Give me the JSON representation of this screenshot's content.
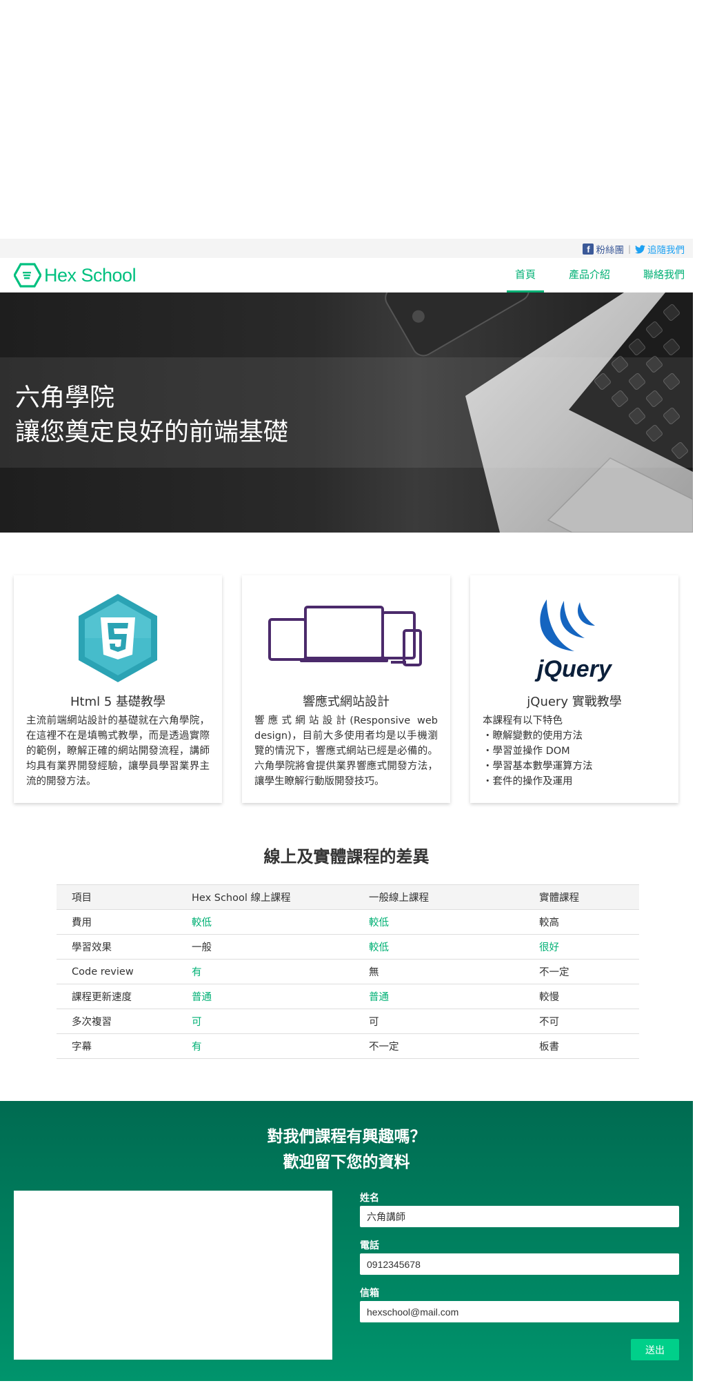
{
  "topbar": {
    "facebook_label": "粉絲團",
    "twitter_label": "追隨我們"
  },
  "logo": {
    "text": "Hex School",
    "icon": "hexagon-logo-icon"
  },
  "nav": {
    "items": [
      {
        "label": "首頁",
        "active": true
      },
      {
        "label": "產品介紹",
        "active": false
      },
      {
        "label": "聯絡我們",
        "active": false
      }
    ]
  },
  "hero": {
    "line1": "六角學院",
    "line2": "讓您奠定良好的前端基礎"
  },
  "cards": [
    {
      "icon": "html5-badge-icon",
      "title": "Html 5 基礎教學",
      "text": "主流前端網站設計的基礎就在六角學院，在這裡不在是填鴨式教學，而是透過實際的範例，瞭解正確的網站開發流程，講師均具有業界開發經驗，讓學員學習業界主流的開發方法。"
    },
    {
      "icon": "responsive-devices-icon",
      "title": "響應式網站設計",
      "text": "響應式網站設計(Responsive web design)，目前大多使用者均是以手機瀏覽的情況下，響應式網站已經是必備的。六角學院將會提供業界響應式開發方法，讓學生瞭解行動版開發技巧。"
    },
    {
      "icon": "jquery-logo-icon",
      "title": "jQuery 實戰教學",
      "intro": "本課程有以下特色",
      "list": [
        "・瞭解變數的使用方法",
        "・學習並操作 DOM",
        "・學習基本數學運算方法",
        "・套件的操作及運用"
      ]
    }
  ],
  "compare": {
    "title": "線上及實體課程的差異",
    "headers": [
      "項目",
      "Hex School 線上課程",
      "一般線上課程",
      "實體課程"
    ],
    "rows": [
      {
        "cells": [
          "費用",
          "較低",
          "較低",
          "較高"
        ],
        "green": [
          1,
          2
        ]
      },
      {
        "cells": [
          "學習效果",
          "一般",
          "較低",
          "很好"
        ],
        "green": [
          2,
          3
        ]
      },
      {
        "cells": [
          "Code review",
          "有",
          "無",
          "不一定"
        ],
        "green": [
          1
        ]
      },
      {
        "cells": [
          "課程更新速度",
          "普通",
          "普通",
          "較慢"
        ],
        "green": [
          1,
          2
        ]
      },
      {
        "cells": [
          "多次複習",
          "可",
          "可",
          "不可"
        ],
        "green": [
          1
        ]
      },
      {
        "cells": [
          "字幕",
          "有",
          "不一定",
          "板書"
        ],
        "green": [
          1
        ]
      }
    ],
    "accent": "#00b074"
  },
  "contact": {
    "title_line1": "對我們課程有興趣嗎？",
    "title_line2": "歡迎留下您的資料",
    "name_label": "姓名",
    "name_value": "六角講師",
    "phone_label": "電話",
    "phone_value": "0912345678",
    "email_label": "信箱",
    "email_value": "hexschool@mail.com",
    "submit_label": "送出"
  }
}
